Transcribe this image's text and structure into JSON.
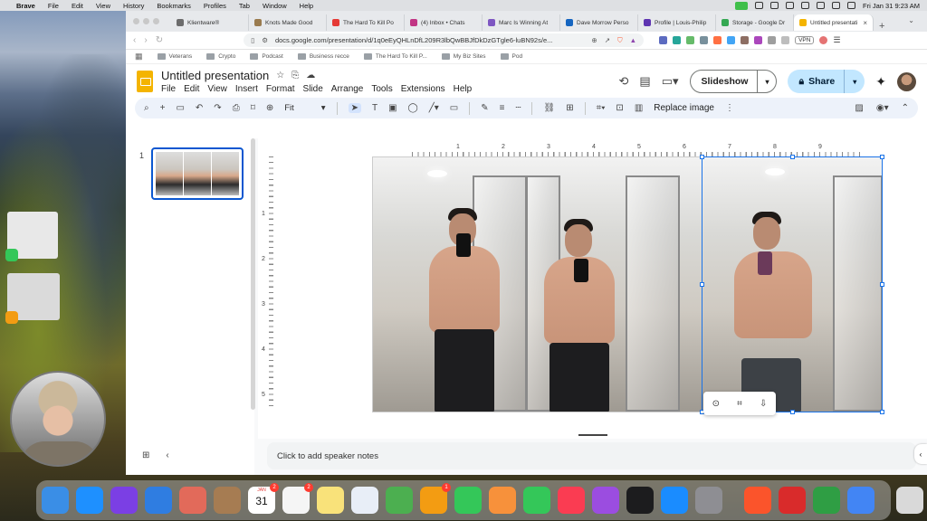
{
  "menubar": {
    "app": "Brave",
    "items": [
      "File",
      "Edit",
      "View",
      "History",
      "Bookmarks",
      "Profiles",
      "Tab",
      "Window",
      "Help"
    ],
    "datetime": "Fri Jan 31  9:23 AM"
  },
  "browser": {
    "tabs": [
      {
        "label": "Klientware®",
        "color": "#6c6c6c"
      },
      {
        "label": "Knots Made Good",
        "color": "#9a7b4f"
      },
      {
        "label": "The Hard To Kill Po",
        "color": "#e53935"
      },
      {
        "label": "(4) Inbox • Chats",
        "color": "#c13584"
      },
      {
        "label": "Marc Is Winning At",
        "color": "#7e57c2"
      },
      {
        "label": "Dave Morrow Perso",
        "color": "#1565c0"
      },
      {
        "label": "Profile | Louis-Philip",
        "color": "#5e35b1"
      },
      {
        "label": "Storage - Google Dr",
        "color": "#34a853"
      },
      {
        "label": "Untitled presentati",
        "color": "#f4b400"
      }
    ],
    "url": "docs.google.com/presentation/d/1q0eEyQHLnDfL209R3lbQwBBJfDkDzGTgle6-luBN92s/e...",
    "vpn_label": "VPN",
    "bookmarks": [
      "Veterans",
      "Crypto",
      "Podcast",
      "Business recce",
      "The Hard To Kill P...",
      "My Biz Sites",
      "Pod"
    ]
  },
  "slides": {
    "doc_title": "Untitled presentation",
    "menus": [
      "File",
      "Edit",
      "View",
      "Insert",
      "Format",
      "Slide",
      "Arrange",
      "Tools",
      "Extensions",
      "Help"
    ],
    "slideshow_label": "Slideshow",
    "share_label": "Share",
    "zoom": "Fit",
    "replace_image": "Replace image",
    "slide_number": "1",
    "ruler_h": [
      "1",
      "2",
      "3",
      "4",
      "5",
      "6",
      "7",
      "8",
      "9"
    ],
    "ruler_v": [
      "1",
      "2",
      "3",
      "4",
      "5"
    ],
    "speaker_notes_placeholder": "Click to add speaker notes"
  },
  "dock": {
    "calendar_month": "JAN",
    "calendar_day": "31",
    "calendar_badge": "2",
    "reminders_badge": "2",
    "photos_badge": "1",
    "icons": [
      {
        "name": "finder",
        "color": "#3a8ee6"
      },
      {
        "name": "safari",
        "color": "#1e90ff"
      },
      {
        "name": "siri",
        "color": "#7b3fe4"
      },
      {
        "name": "mail",
        "color": "#2f7de1"
      },
      {
        "name": "launchpad",
        "color": "#e26a5a"
      },
      {
        "name": "contacts",
        "color": "#a67c52"
      },
      {
        "name": "calendar",
        "color": "#ffffff"
      },
      {
        "name": "reminders",
        "color": "#f5f5f5"
      },
      {
        "name": "notes",
        "color": "#f9e27a"
      },
      {
        "name": "freeform",
        "color": "#e8eef7"
      },
      {
        "name": "maps",
        "color": "#4caf50"
      },
      {
        "name": "photos",
        "color": "#f39c12"
      },
      {
        "name": "messages",
        "color": "#34c759"
      },
      {
        "name": "pages",
        "color": "#f7913b"
      },
      {
        "name": "numbers",
        "color": "#34c759"
      },
      {
        "name": "music",
        "color": "#fa3c52"
      },
      {
        "name": "podcasts",
        "color": "#9b4de0"
      },
      {
        "name": "tv",
        "color": "#1c1c1e"
      },
      {
        "name": "app-store",
        "color": "#1a8cff"
      },
      {
        "name": "system-settings",
        "color": "#8e8e93"
      },
      {
        "name": "brave",
        "color": "#fb542b"
      },
      {
        "name": "app-red",
        "color": "#d92b2b"
      },
      {
        "name": "app-green",
        "color": "#2f9e44"
      },
      {
        "name": "chrome",
        "color": "#4285f4"
      },
      {
        "name": "trash",
        "color": "#d9d9d9"
      }
    ]
  }
}
